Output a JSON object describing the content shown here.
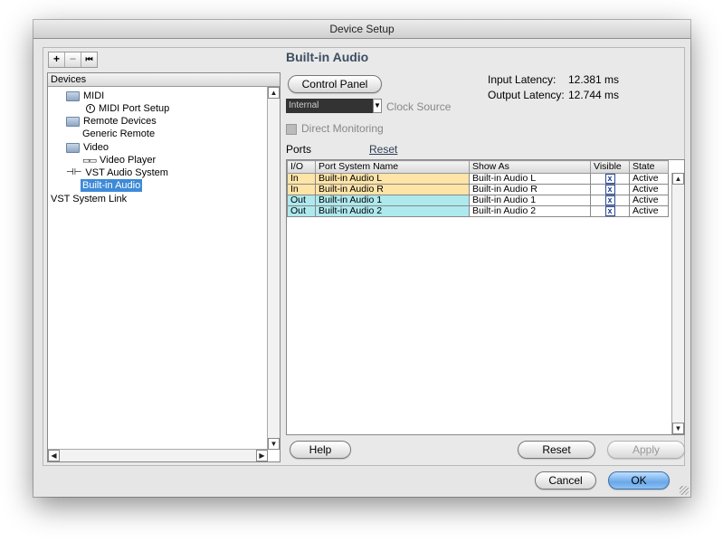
{
  "window": {
    "title": "Device Setup"
  },
  "toolbar": {
    "add": "+",
    "remove": "−",
    "reset": "⏮"
  },
  "tree": {
    "header": "Devices",
    "items": [
      {
        "label": "MIDI",
        "icon": "folder-icon"
      },
      {
        "label": "MIDI Port Setup",
        "icon": "clock-icon"
      },
      {
        "label": "Remote Devices",
        "icon": "folder-icon"
      },
      {
        "label": "Generic Remote",
        "icon": ""
      },
      {
        "label": "Video",
        "icon": "folder-icon"
      },
      {
        "label": "Video Player",
        "icon": "video-icon"
      },
      {
        "label": "VST Audio System",
        "icon": "vst-icon"
      },
      {
        "label": "Built-in Audio",
        "icon": "",
        "selected": true
      },
      {
        "label": "VST System Link",
        "icon": ""
      }
    ]
  },
  "detail": {
    "title": "Built-in Audio",
    "control_panel": "Control Panel",
    "input_latency_label": "Input Latency:",
    "input_latency_value": "12.381 ms",
    "output_latency_label": "Output Latency:",
    "output_latency_value": "12.744 ms",
    "clock_value": "Internal",
    "clock_label": "Clock Source",
    "direct_monitoring": "Direct Monitoring",
    "ports_label": "Ports",
    "reset_link": "Reset"
  },
  "ports_table": {
    "columns": [
      "I/O",
      "Port System Name",
      "Show As",
      "Visible",
      "State"
    ],
    "rows": [
      {
        "io": "In",
        "name": "Built-in Audio L",
        "show_as": "Built-in Audio L",
        "visible": "x",
        "state": "Active"
      },
      {
        "io": "In",
        "name": "Built-in Audio R",
        "show_as": "Built-in Audio R",
        "visible": "x",
        "state": "Active"
      },
      {
        "io": "Out",
        "name": "Built-in Audio 1",
        "show_as": "Built-in Audio 1",
        "visible": "x",
        "state": "Active"
      },
      {
        "io": "Out",
        "name": "Built-in Audio 2",
        "show_as": "Built-in Audio 2",
        "visible": "x",
        "state": "Active"
      }
    ]
  },
  "buttons": {
    "help": "Help",
    "reset": "Reset",
    "apply": "Apply",
    "cancel": "Cancel",
    "ok": "OK"
  },
  "colors": {
    "input_row": "#ffe4a8",
    "output_row": "#aee9ee",
    "selection": "#3d8ad8"
  }
}
